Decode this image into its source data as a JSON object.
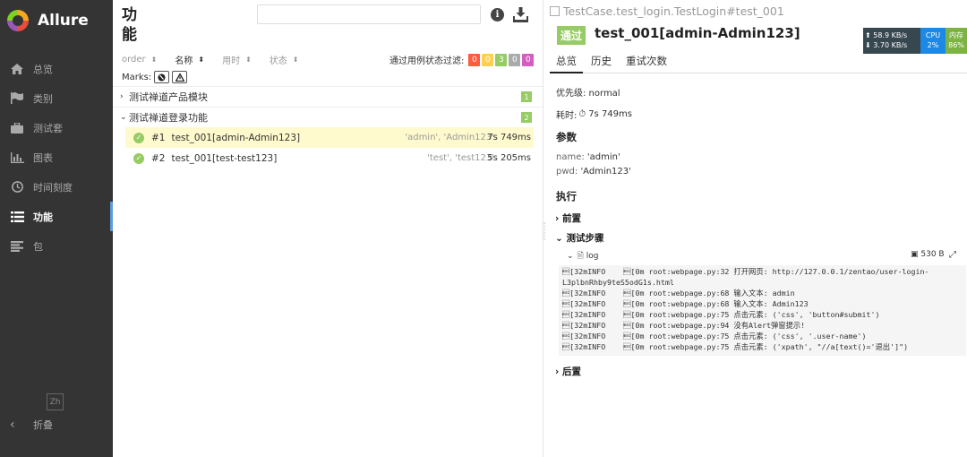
{
  "brand": {
    "name": "Allure"
  },
  "sidebar": {
    "items": [
      {
        "label": "总览",
        "icon": "home-icon"
      },
      {
        "label": "类别",
        "icon": "flag-icon"
      },
      {
        "label": "测试套",
        "icon": "briefcase-icon"
      },
      {
        "label": "图表",
        "icon": "bar-chart-icon"
      },
      {
        "label": "时间刻度",
        "icon": "clock-icon"
      },
      {
        "label": "功能",
        "icon": "list-icon",
        "active": true
      },
      {
        "label": "包",
        "icon": "package-icon"
      }
    ],
    "lang": "Zh",
    "collapse_label": "折叠"
  },
  "middle": {
    "title": "功能",
    "search_value": "",
    "sort_columns": [
      "order",
      "名称",
      "用时",
      "状态"
    ],
    "filter_label": "通过用例状态过滤:",
    "status_counts": [
      {
        "value": "0",
        "color": "#fd5a3e"
      },
      {
        "value": "0",
        "color": "#ffd050"
      },
      {
        "value": "3",
        "color": "#97cc64"
      },
      {
        "value": "0",
        "color": "#aaaaaa"
      },
      {
        "value": "0",
        "color": "#d35ebe"
      }
    ],
    "marks_label": "Marks:",
    "groups": [
      {
        "label": "测试禅道产品模块",
        "count": "1",
        "expanded": false
      },
      {
        "label": "测试禅道登录功能",
        "count": "2",
        "expanded": true
      }
    ],
    "tests": [
      {
        "num": "#1",
        "name": "test_001[admin-Admin123]",
        "params": "'admin', 'Admin123'",
        "duration": "7s 749ms",
        "selected": true
      },
      {
        "num": "#2",
        "name": "test_001[test-test123]",
        "params": "'test', 'test123'",
        "duration": "5s 205ms",
        "selected": false
      }
    ]
  },
  "detail": {
    "breadcrumb": "TestCase.test_login.TestLogin#test_001",
    "status": "通过",
    "title": "test_001[admin-Admin123]",
    "perf": {
      "up": "58.9 KB/s",
      "down": "3.70 KB/s",
      "cpu_label": "CPU",
      "cpu": "2%",
      "mem_label": "内存",
      "mem": "86%"
    },
    "tabs": [
      "总览",
      "历史",
      "重试次数"
    ],
    "priority": "优先级: normal",
    "duration_label": "耗时:",
    "duration": "7s 749ms",
    "params_title": "参数",
    "params": [
      {
        "key": "name:",
        "value": "'admin'"
      },
      {
        "key": "pwd:",
        "value": "'Admin123'"
      }
    ],
    "exec_title": "执行",
    "setup": "前置",
    "steps": "测试步骤",
    "log_name": "log",
    "log_size": "530 B",
    "log_lines": [
      "\u001b[32mINFO    \u001b[0m root:webpage.py:32 打开网页: http://127.0.0.1/zentao/user-login-",
      "L3plbnRhby9teS5odG1s.html",
      "\u001b[32mINFO    \u001b[0m root:webpage.py:68 输入文本: admin",
      "\u001b[32mINFO    \u001b[0m root:webpage.py:68 输入文本: Admin123",
      "\u001b[32mINFO    \u001b[0m root:webpage.py:75 点击元素: ('css', 'button#submit')",
      "\u001b[32mINFO    \u001b[0m root:webpage.py:94 没有Alert弹窗提示!",
      "\u001b[32mINFO    \u001b[0m root:webpage.py:75 点击元素: ('css', '.user-name')",
      "\u001b[32mINFO    \u001b[0m root:webpage.py:75 点击元素: ('xpath', \"//a[text()='退出']\")"
    ],
    "teardown": "后置"
  }
}
